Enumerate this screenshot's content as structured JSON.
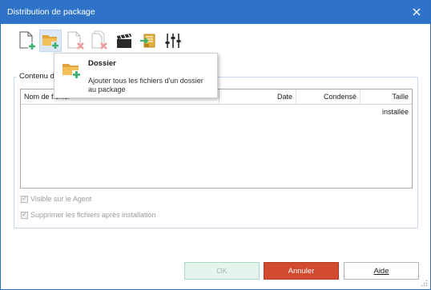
{
  "window": {
    "title": "Distribution de package"
  },
  "toolbar": {
    "buttons": [
      {
        "icon": "new-file-icon",
        "state": "normal"
      },
      {
        "icon": "add-folder-icon",
        "state": "active"
      },
      {
        "icon": "remove-file-icon",
        "state": "disabled"
      },
      {
        "icon": "remove-all-icon",
        "state": "disabled"
      },
      {
        "icon": "clapperboard-icon",
        "state": "normal"
      },
      {
        "icon": "import-icon",
        "state": "normal"
      },
      {
        "icon": "settings-sliders-icon",
        "state": "normal"
      }
    ]
  },
  "tooltip": {
    "title": "Dossier",
    "description": "Ajouter tous les fichiers d'un dossier au package"
  },
  "content": {
    "group_label": "Contenu de",
    "columns": [
      "Nom de fichier",
      "Date",
      "Condensé",
      "Taille installée"
    ]
  },
  "options": {
    "visible_agent": {
      "label": "Visible sur le Agent",
      "checked": true,
      "enabled": false
    },
    "delete_after_install": {
      "label": "Supprimer les fichiers après installation",
      "checked": true,
      "enabled": false
    }
  },
  "buttons": {
    "ok": "OK",
    "cancel": "Annuler",
    "help": "Aide"
  },
  "colors": {
    "titlebar": "#2f73c9",
    "cancel": "#d24a2f",
    "ok_disabled": "#e6f4ee",
    "plus_green": "#3cb371",
    "remove_red": "#e04b4b",
    "folder": "#e0a43a"
  }
}
